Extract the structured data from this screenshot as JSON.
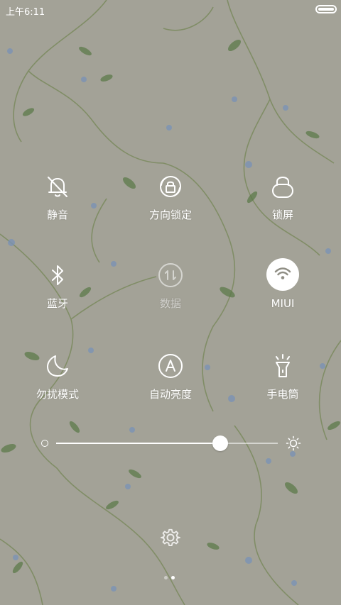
{
  "status_bar": {
    "time": "上午6:11",
    "battery_level": 1.0
  },
  "tiles": [
    {
      "id": "mute",
      "label": "静音",
      "icon": "bell-off-icon",
      "active": false
    },
    {
      "id": "rotation-lock",
      "label": "方向锁定",
      "icon": "rotation-lock-icon",
      "active": false
    },
    {
      "id": "lock-screen",
      "label": "锁屏",
      "icon": "lock-icon",
      "active": false
    },
    {
      "id": "bluetooth",
      "label": "蓝牙",
      "icon": "bluetooth-icon",
      "active": false
    },
    {
      "id": "data",
      "label": "数据",
      "icon": "mobile-data-icon",
      "active": false,
      "disabled": true
    },
    {
      "id": "wifi",
      "label": "MIUI",
      "icon": "wifi-icon",
      "active": true
    },
    {
      "id": "do-not-disturb",
      "label": "勿扰模式",
      "icon": "moon-icon",
      "active": false
    },
    {
      "id": "auto-brightness",
      "label": "自动亮度",
      "icon": "auto-brightness-icon",
      "active": false
    },
    {
      "id": "flashlight",
      "label": "手电筒",
      "icon": "flashlight-icon",
      "active": false
    }
  ],
  "brightness": {
    "level": 0.74,
    "low_icon": "brightness-low-icon",
    "high_icon": "brightness-high-icon"
  },
  "settings_icon": "gear-icon",
  "page_indicator": {
    "count": 2,
    "current": 2
  },
  "colors": {
    "background": "#a3a297",
    "leaf": "#5d7a4a",
    "flower": "#7b93b5",
    "icon": "#ffffff",
    "active_fill": "#ffffff"
  }
}
